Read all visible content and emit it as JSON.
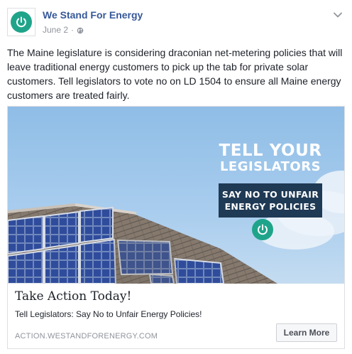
{
  "post": {
    "page_name": "We Stand For Energy",
    "date": "June 2",
    "separator": "·",
    "privacy_icon": "globe-icon",
    "options_icon": "chevron-down-icon",
    "avatar_icon": "power-icon",
    "text": "The Maine legislature is considering draconian net-metering policies that will leave traditional energy customers to pick up the tab for private solar customers. Tell legislators to vote no on LD 1504 to ensure all Maine energy customers are treated fairly."
  },
  "ad": {
    "image_text": {
      "line1": "TELL YOUR",
      "line2": "LEGISLATORS",
      "box_line1": "SAY NO TO UNFAIR",
      "box_line2": "ENERGY POLICIES"
    },
    "title": "Take Action Today!",
    "description": "Tell Legislators: Say No to Unfair Energy Policies!",
    "domain": "ACTION.WESTANDFORENERGY.COM",
    "button_label": "Learn More"
  },
  "colors": {
    "brand_green": "#1fa48a",
    "link_blue": "#365899",
    "banner_navy": "#1f3a55",
    "meta_gray": "#90949c"
  }
}
